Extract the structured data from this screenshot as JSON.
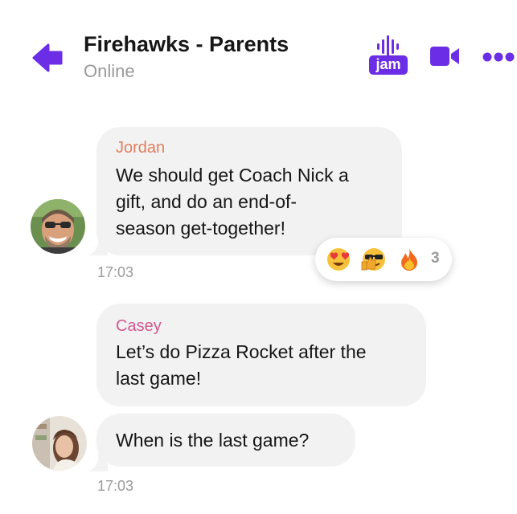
{
  "header": {
    "title": "Firehawks - Parents",
    "status": "Online",
    "jam_label": "jam",
    "accent_color": "#6b2de6"
  },
  "messages": [
    {
      "sender": "Jordan",
      "sender_color": "#e07f5f",
      "lines": [
        "We should get Coach Nick a",
        "gift, and do an end-of-",
        "season get-together!"
      ],
      "time": "17:03",
      "reactions": {
        "emojis": [
          "heart-eyes-face",
          "sunglasses-thumbs-up-face",
          "fire"
        ],
        "count": "3"
      }
    },
    {
      "sender": "Casey",
      "sender_color": "#d2578f",
      "lines": [
        "Let’s do Pizza Rocket after the",
        "last game!"
      ]
    },
    {
      "lines": [
        "When is the last game?"
      ],
      "time": "17:03"
    }
  ]
}
